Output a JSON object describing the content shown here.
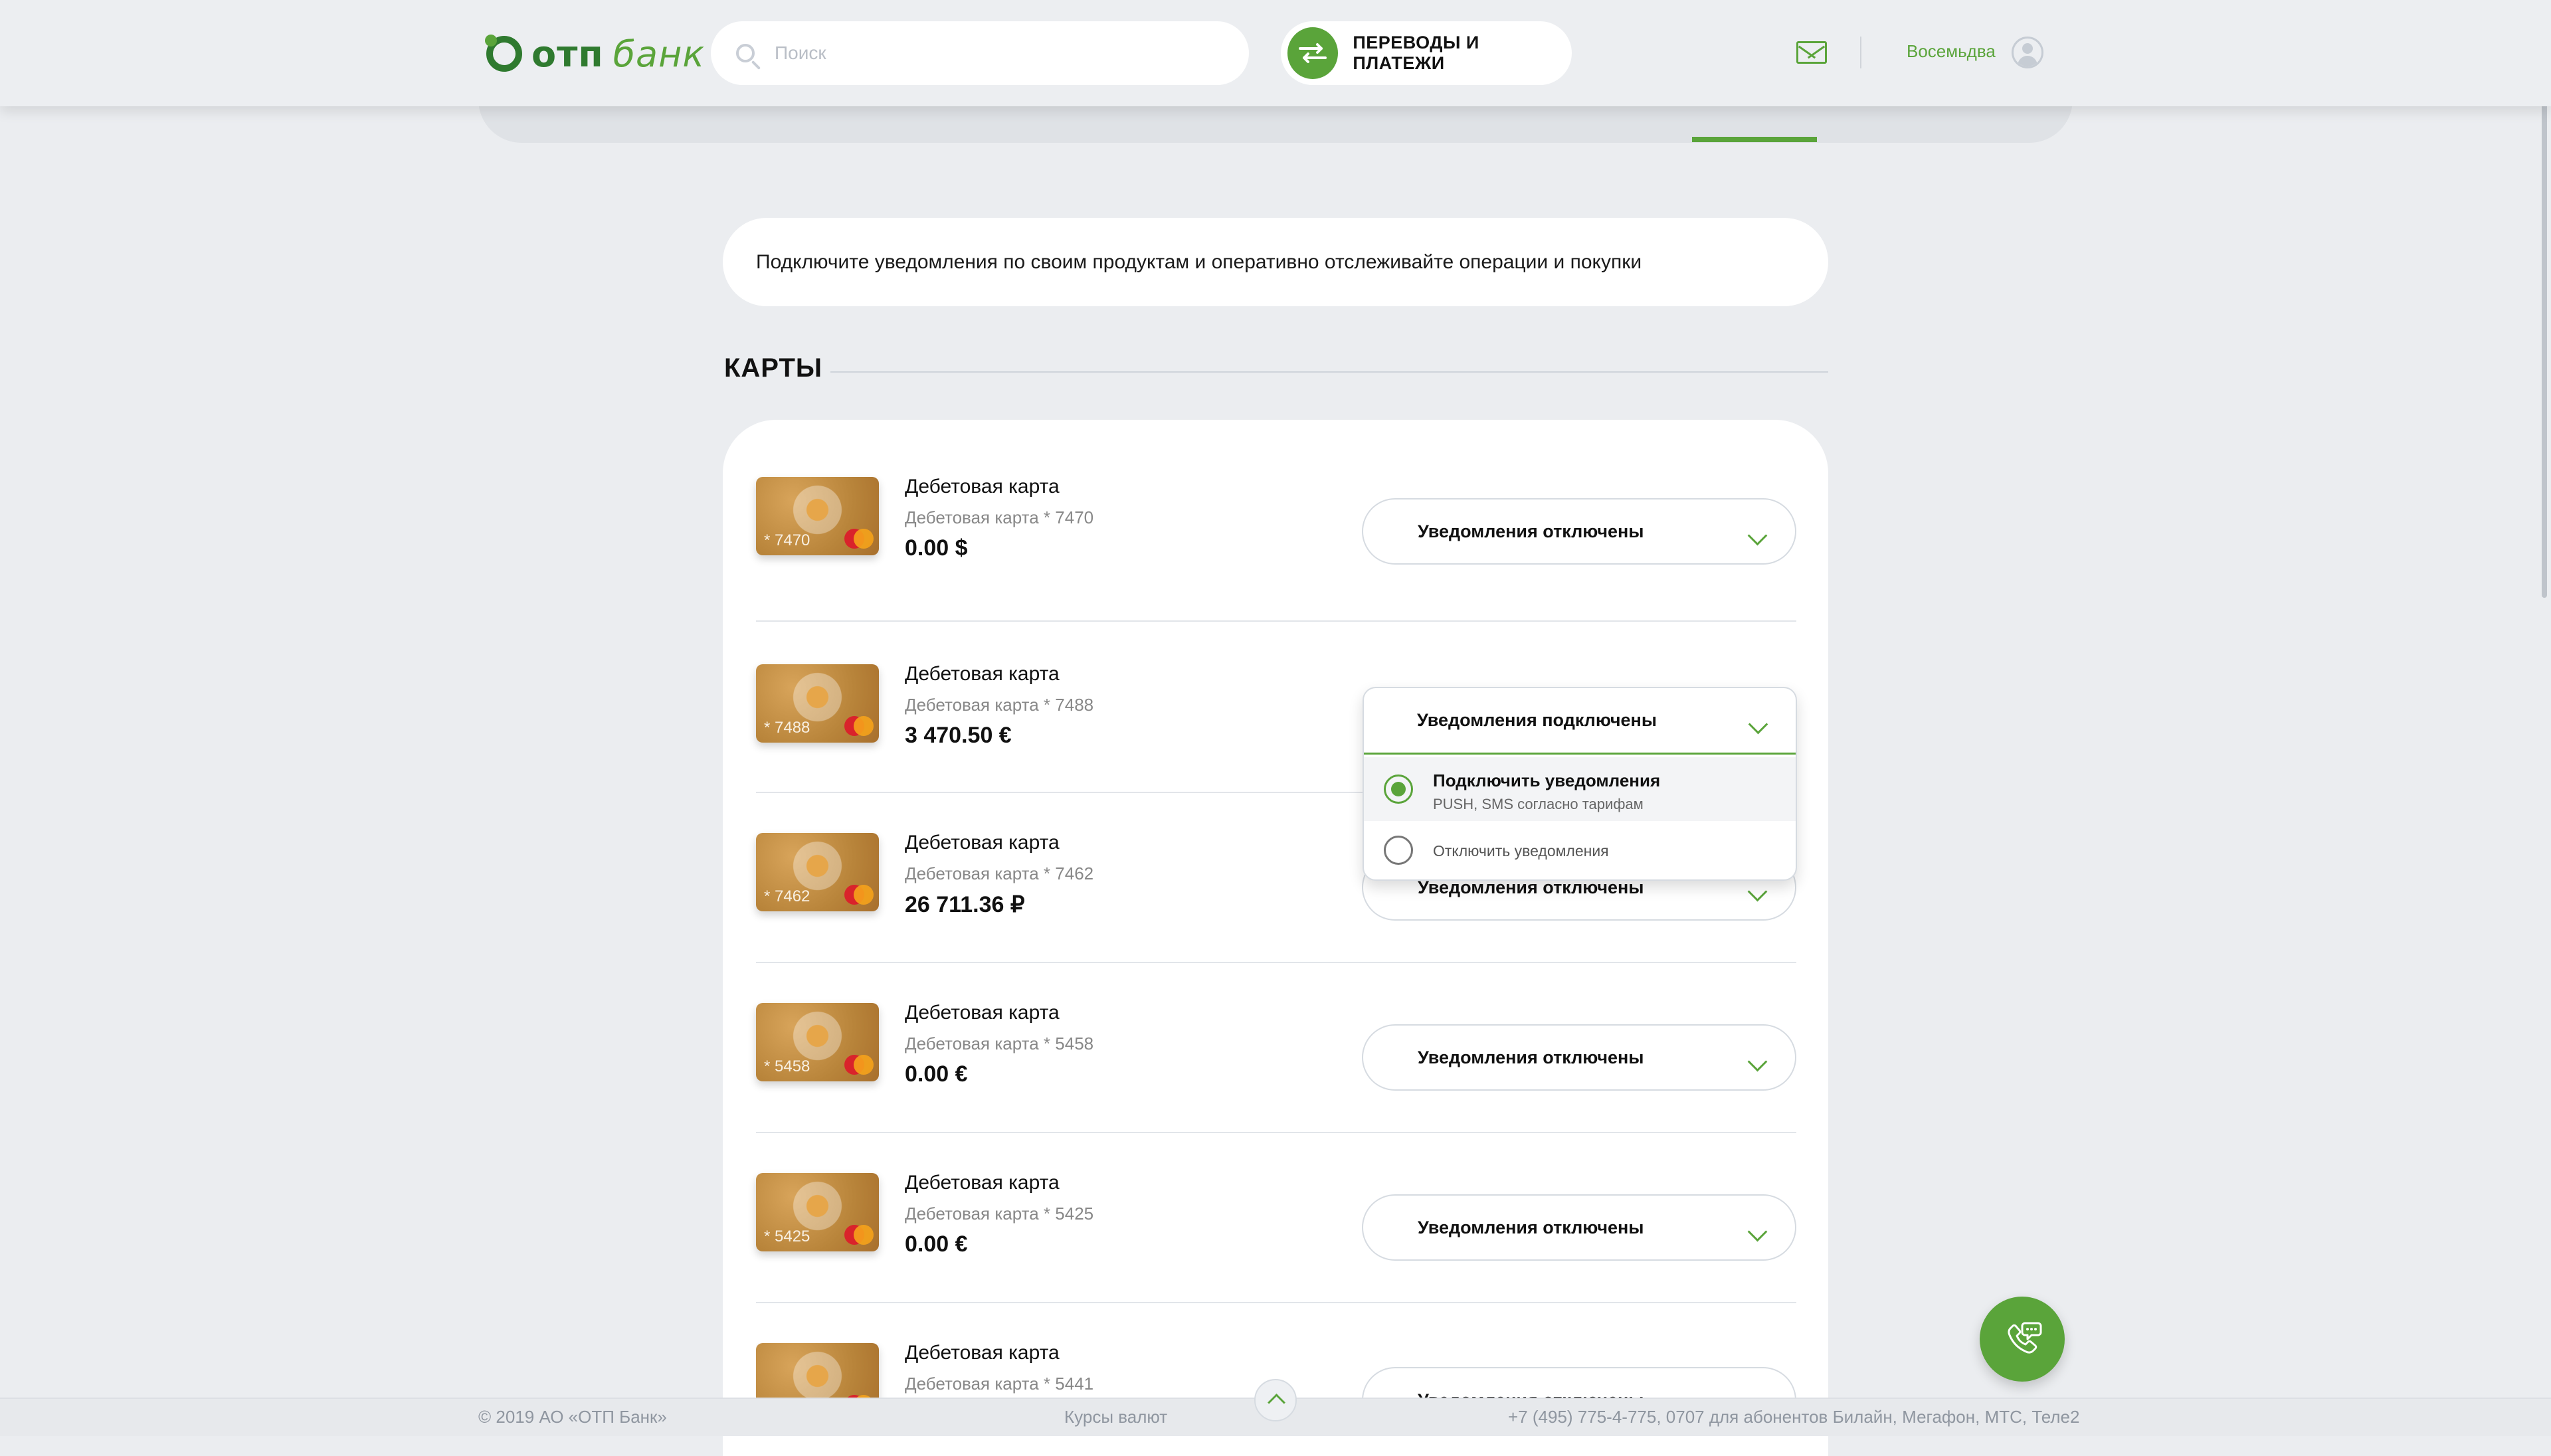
{
  "header": {
    "logo_text_1": "отп",
    "logo_text_2": "банк",
    "search_placeholder": "Поиск",
    "transfers_label": "ПЕРЕВОДЫ И ПЛАТЕЖИ",
    "username": "Восемьдва"
  },
  "banner": {
    "text": "Подключите уведомления по своим продуктам и оперативно отслеживайте операции и покупки"
  },
  "section": {
    "title": "КАРТЫ"
  },
  "cards": [
    {
      "name": "Дебетовая карта",
      "sub": "Дебетовая карта * 7470",
      "last4": "* 7470",
      "balance": "0.00 $",
      "notif": "Уведомления отключены"
    },
    {
      "name": "Дебетовая карта",
      "sub": "Дебетовая карта * 7488",
      "last4": "* 7488",
      "balance": "3 470.50 €",
      "notif": "Уведомления подключены"
    },
    {
      "name": "Дебетовая карта",
      "sub": "Дебетовая карта * 7462",
      "last4": "* 7462",
      "balance": "26 711.36 ₽",
      "notif": "Уведомления отключены"
    },
    {
      "name": "Дебетовая карта",
      "sub": "Дебетовая карта * 5458",
      "last4": "* 5458",
      "balance": "0.00 €",
      "notif": "Уведомления отключены"
    },
    {
      "name": "Дебетовая карта",
      "sub": "Дебетовая карта * 5425",
      "last4": "* 5425",
      "balance": "0.00 €",
      "notif": "Уведомления отключены"
    },
    {
      "name": "Дебетовая карта",
      "sub": "Дебетовая карта * 5441",
      "last4": "",
      "balance": "",
      "notif": "Уведомления отключены"
    }
  ],
  "dropdown": {
    "head": "Уведомления подключены",
    "option1_title": "Подключить уведомления",
    "option1_sub": "PUSH, SMS согласно тарифам",
    "option2_title": "Отключить уведомления"
  },
  "footer": {
    "copyright": "© 2019 АО «ОТП Банк»",
    "rates": "Курсы валют",
    "phones": "+7 (495) 775-4-775,  0707 для абонентов Билайн, Мегафон, МТС, Теле2"
  },
  "colors": {
    "accent": "#5aa43a",
    "accent_dark": "#2f7a2f",
    "background": "#ebedf0"
  },
  "icons": {
    "search": "search-icon",
    "transfers": "swap-arrows-icon",
    "mail": "mail-icon",
    "user": "user-avatar-icon",
    "chevron": "chevron-down-icon",
    "radio": "radio-icon",
    "up": "chevron-up-icon",
    "call": "phone-chat-icon"
  }
}
